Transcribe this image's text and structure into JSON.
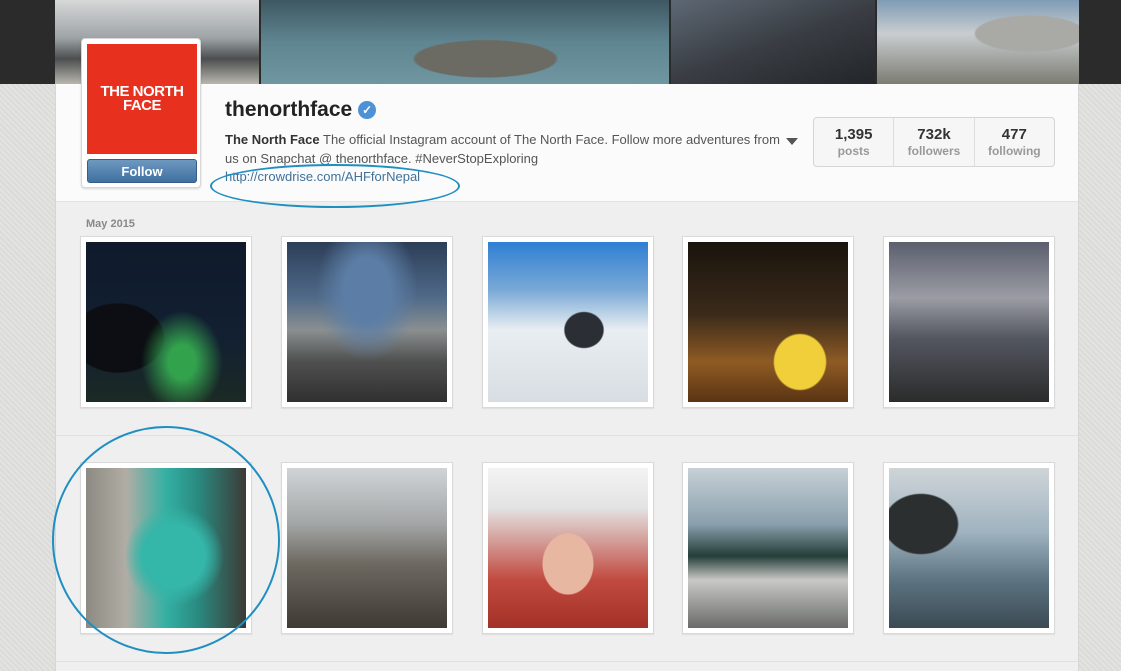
{
  "profile": {
    "logo_text": "THE NORTH FACE",
    "follow_label": "Follow",
    "username": "thenorthface",
    "verified_icon": "verified-badge-icon",
    "bio_name": "The North Face",
    "bio_text": "The official Instagram account of The North Face. Follow more adventures from us on Snapchat @ thenorthface. #NeverStopExploring",
    "link": "http://crowdrise.com/AHFforNepal"
  },
  "stats": [
    {
      "value": "1,395",
      "label": "posts"
    },
    {
      "value": "732k",
      "label": "followers"
    },
    {
      "value": "477",
      "label": "following"
    }
  ],
  "feed": {
    "month_label": "May 2015",
    "photos": [
      "aurora-night-photo",
      "rocky-field-hiker-photo",
      "snow-mountain-skier-photo",
      "forest-tent-lights-photo",
      "cloudy-valley-photo",
      "climber-teal-tank-photo",
      "beach-driftwood-photo",
      "climber-bubblegum-selfie-photo",
      "mountain-road-photo",
      "lake-rock-standing-photo"
    ]
  },
  "colors": {
    "brand_red": "#e8301f",
    "follow_blue": "#3f71a0",
    "link_blue": "#3f729b",
    "annotation": "#1f8fc1"
  }
}
